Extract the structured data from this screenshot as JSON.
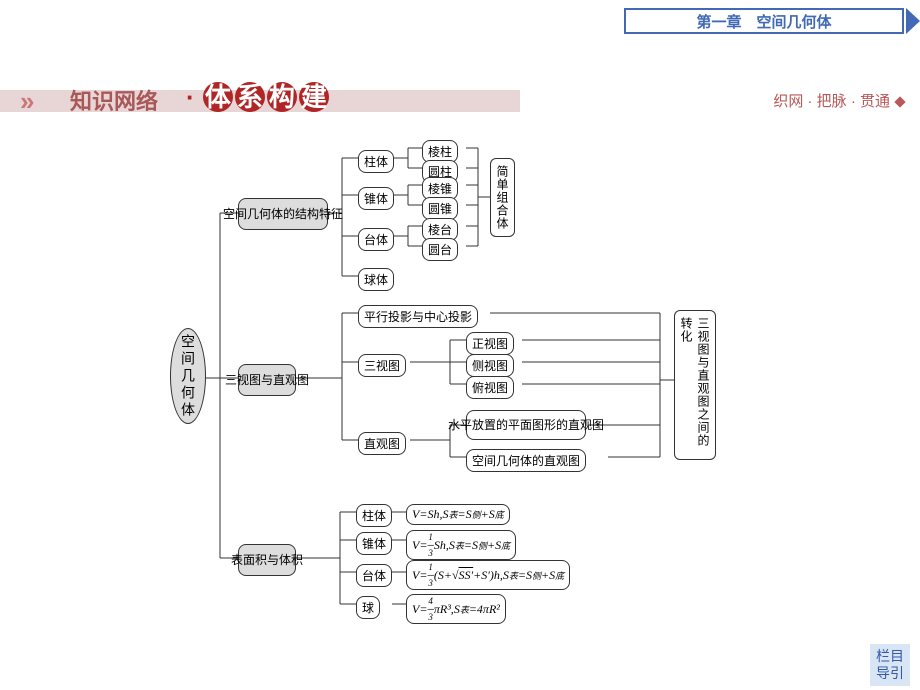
{
  "chapter": "第一章　空间几何体",
  "section": {
    "label": "知识网络",
    "title": [
      "体",
      "系",
      "构",
      "建"
    ]
  },
  "subtitle": "织网 · 把脉 · 贯通",
  "root": "空间几何体",
  "l2": {
    "struct": "空间几何体的结构特征",
    "view": "三视图与直观图",
    "sv": "表面积与体积"
  },
  "struct": {
    "zhu": "柱体",
    "zhui": "锥体",
    "tai": "台体",
    "qiu": "球体",
    "lz": "棱柱",
    "yz": "圆柱",
    "lzh": "棱锥",
    "yzh": "圆锥",
    "lt": "棱台",
    "yt": "圆台",
    "combo": "简单组合体"
  },
  "view": {
    "proj": "平行投影与中心投影",
    "sst": "三视图",
    "zg": "直观图",
    "zheng": "正视图",
    "ce": "侧视图",
    "fu": "俯视图",
    "plane": "水平放置的平面图形的直观图",
    "space": "空间几何体的直观图",
    "trans": "三视图与直观图之间的转化"
  },
  "sv": {
    "zhu": "柱体",
    "zhui": "锥体",
    "tai": "台体",
    "qiu": "球"
  },
  "formulas": {
    "zhu": "V=Sh, S表=S侧+S底",
    "zhui": "V=⅓Sh, S表=S侧+S底",
    "tai": "V=⅓(S+√(SS′)+S′)h, S表=S侧+S底",
    "qiu": "V=⁴⁄₃πR³, S表=4πR²"
  },
  "nav": {
    "l1": "栏目",
    "l2": "导引"
  }
}
